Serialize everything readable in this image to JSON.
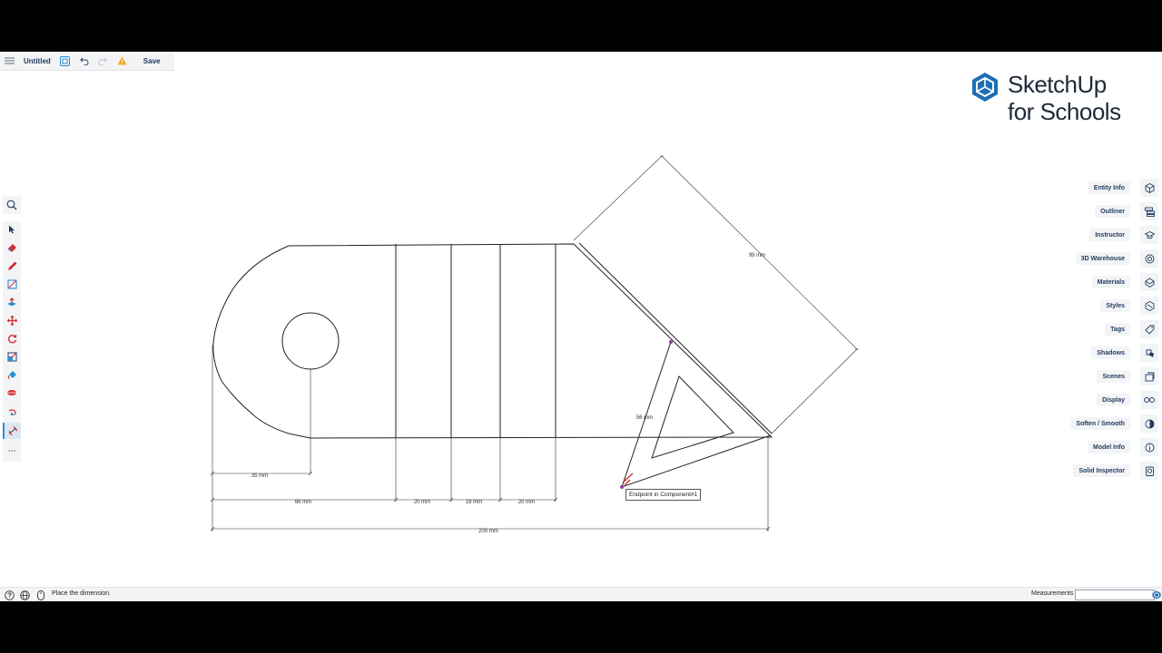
{
  "toolbar": {
    "title": "Untitled",
    "save_label": "Save",
    "icons": [
      "menu-icon",
      "model-icon",
      "undo-icon",
      "redo-icon",
      "warning-icon"
    ]
  },
  "logo": {
    "line1": "SketchUp",
    "line2": "for Schools",
    "color": "#1d6fb4"
  },
  "right_panel": [
    {
      "label": "Entity Info",
      "icon": "cube-icon"
    },
    {
      "label": "Outliner",
      "icon": "outliner-icon"
    },
    {
      "label": "Instructor",
      "icon": "graduation-cap-icon"
    },
    {
      "label": "3D Warehouse",
      "icon": "warehouse-icon"
    },
    {
      "label": "Materials",
      "icon": "materials-icon"
    },
    {
      "label": "Styles",
      "icon": "styles-icon"
    },
    {
      "label": "Tags",
      "icon": "tag-icon"
    },
    {
      "label": "Shadows",
      "icon": "shadows-icon"
    },
    {
      "label": "Scenes",
      "icon": "scenes-icon"
    },
    {
      "label": "Display",
      "icon": "glasses-icon"
    },
    {
      "label": "Soften / Smooth",
      "icon": "soften-icon"
    },
    {
      "label": "Model Info",
      "icon": "info-icon"
    },
    {
      "label": "Solid Inspector",
      "icon": "solid-inspector-icon"
    }
  ],
  "left_tools": [
    "select-icon",
    "eraser-icon",
    "pencil-icon",
    "rectangle-icon",
    "push-pull-icon",
    "move-icon",
    "rotate-icon",
    "scale-icon",
    "paint-bucket-icon",
    "tape-measure-icon",
    "orbit-icon",
    "dimension-icon",
    "more-icon"
  ],
  "dimensions": {
    "d35": "35 mm",
    "d66": "66 mm",
    "d20a": "20 mm",
    "d18": "18 mm",
    "d20b": "20 mm",
    "d200": "200 mm",
    "d99": "99 mm",
    "d56": "56 mm"
  },
  "tooltip": "Endpoint in Component#1",
  "status": {
    "text": "Place the dimension.",
    "measurements_label": "Measurements",
    "measurements_value": ""
  },
  "colors": {
    "accent": "#2a8fd6",
    "ui_text": "#1f3a5f",
    "tool_red": "#d32f2f"
  }
}
